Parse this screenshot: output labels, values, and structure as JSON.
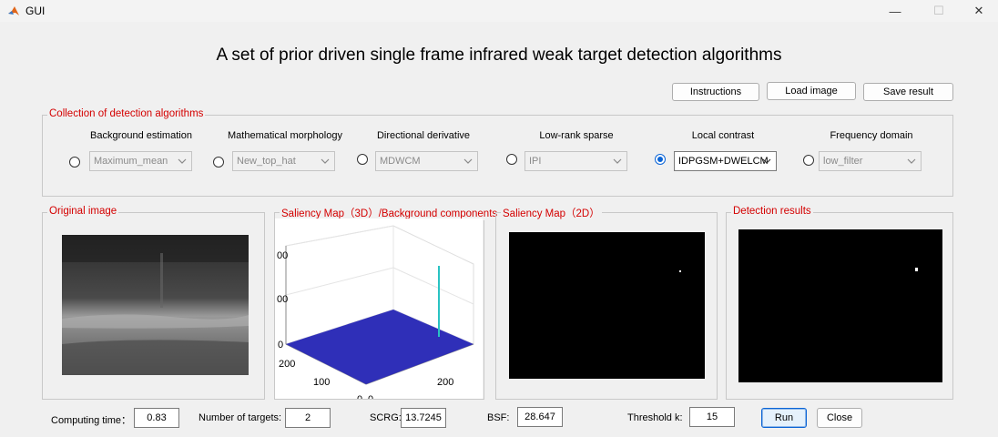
{
  "window": {
    "title": "GUI",
    "controls": {
      "minimize": "—",
      "maximize": "☐",
      "close": "✕"
    }
  },
  "main_title": "A set of prior driven single frame infrared weak target detection algorithms",
  "toolbar": {
    "instructions": "Instructions",
    "load_image": "Load image",
    "save_result": "Save result"
  },
  "algorithms": {
    "group_title": "Collection of detection algorithms",
    "items": [
      {
        "label": "Background estimation",
        "value": "Maximum_mean",
        "selected": false
      },
      {
        "label": "Mathematical morphology",
        "value": "New_top_hat",
        "selected": false
      },
      {
        "label": "Directional derivative",
        "value": "MDWCM",
        "selected": false
      },
      {
        "label": "Low-rank sparse",
        "value": "IPI",
        "selected": false
      },
      {
        "label": "Local contrast",
        "value": "IDPGSM+DWELCM",
        "selected": true
      },
      {
        "label": "Frequency domain",
        "value": "low_filter",
        "selected": false
      }
    ]
  },
  "panels": {
    "original": "Original image",
    "saliency3d": "Saliency Map（3D）/Background components",
    "saliency2d": "Saliency Map（2D）",
    "detection": "Detection results"
  },
  "plot3d": {
    "z_ticks": [
      "00",
      "00",
      "0"
    ],
    "y_ticks": [
      "200",
      "100",
      "0"
    ],
    "x_ticks": [
      "0",
      "200"
    ],
    "surface_color": "#2f2fb8",
    "peak_color": "#29c3c3"
  },
  "metrics": {
    "computing_time_label": "Computing time：",
    "computing_time": "0.83",
    "targets_label": "Number of targets:",
    "targets": "2",
    "scrg_label": "SCRG:",
    "scrg": "13.7245",
    "bsf_label": "BSF:",
    "bsf": "28.647",
    "threshold_label": "Threshold k:",
    "threshold": "15"
  },
  "actions": {
    "run": "Run",
    "close": "Close"
  },
  "colors": {
    "group_title": "#d40000",
    "radio_selected": "#0a64d6"
  }
}
